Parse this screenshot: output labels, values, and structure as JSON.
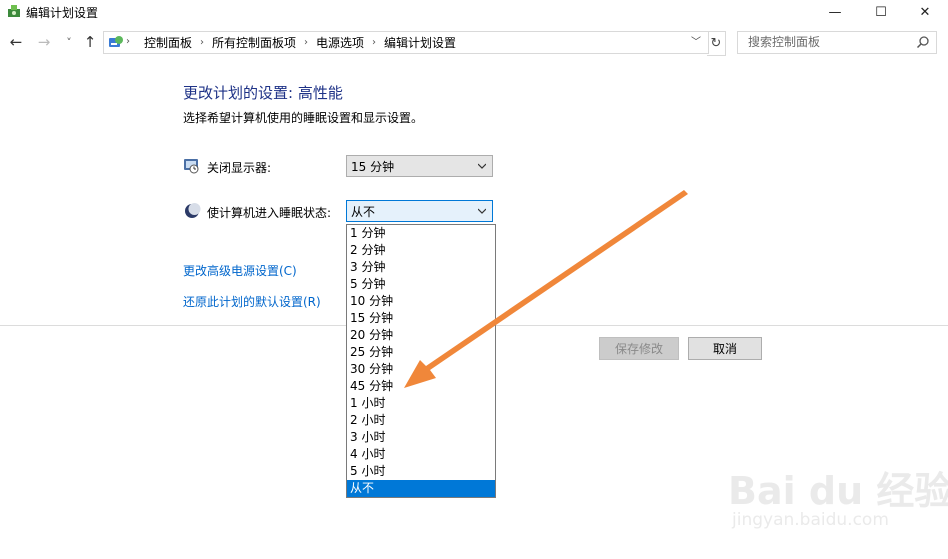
{
  "window": {
    "title": "编辑计划设置",
    "minimize_icon": "—",
    "maximize_icon": "☐",
    "close_icon": "✕"
  },
  "nav": {
    "back_icon": "←",
    "forward_icon": "→",
    "recent_icon": "˅",
    "up_icon": "↑",
    "breadcrumb": [
      "控制面板",
      "所有控制面板项",
      "电源选项",
      "编辑计划设置"
    ],
    "refresh_icon": "↻",
    "search_placeholder": "搜索控制面板"
  },
  "main": {
    "title": "更改计划的设置: 高性能",
    "subtitle": "选择希望计算机使用的睡眠设置和显示设置。",
    "display_label": "关闭显示器:",
    "display_value": "15 分钟",
    "sleep_label": "使计算机进入睡眠状态:",
    "sleep_value": "从不",
    "advanced_link": "更改高级电源设置(C)",
    "restore_link": "还原此计划的默认设置(R)",
    "save_button": "保存修改",
    "cancel_button": "取消",
    "sleep_options": [
      "1 分钟",
      "2 分钟",
      "3 分钟",
      "5 分钟",
      "10 分钟",
      "15 分钟",
      "20 分钟",
      "25 分钟",
      "30 分钟",
      "45 分钟",
      "1 小时",
      "2 小时",
      "3 小时",
      "4 小时",
      "5 小时",
      "从不"
    ],
    "sleep_selected_index": 15
  },
  "watermark": {
    "brand": "Bai du 经验",
    "url": "jingyan.baidu.com"
  },
  "colors": {
    "accent": "#0078d7",
    "title_blue": "#1e3287",
    "link_blue": "#0066cc",
    "arrow_orange": "#f0873a"
  }
}
